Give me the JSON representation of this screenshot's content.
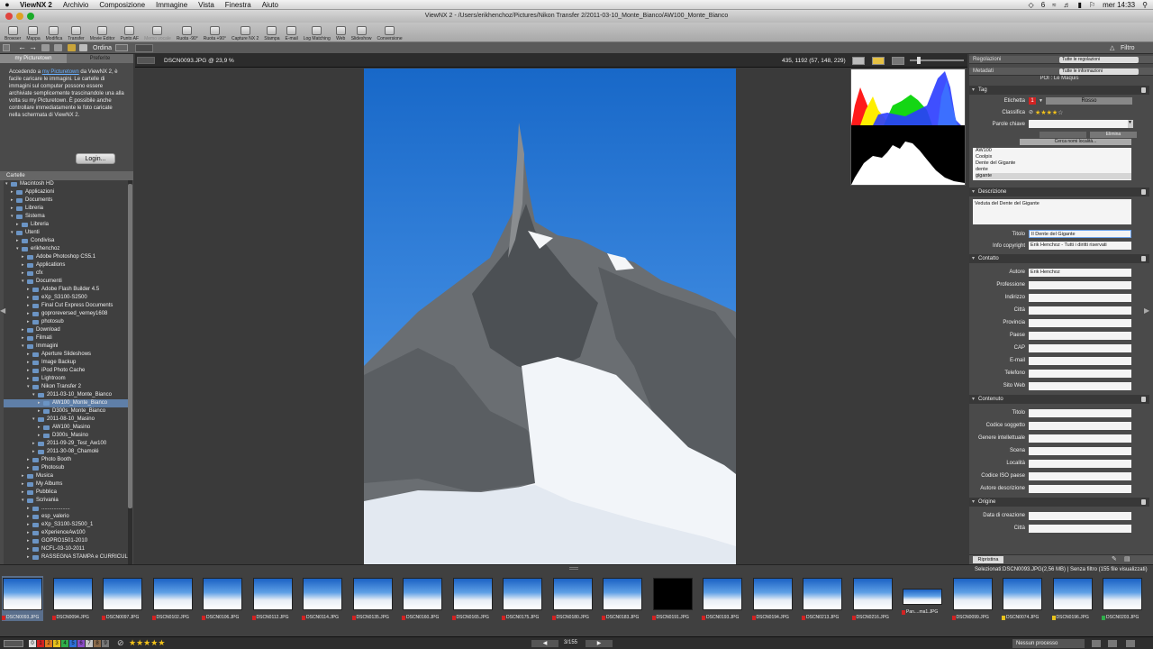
{
  "menubar": {
    "apple": "",
    "app": "ViewNX 2",
    "items": [
      "Archivio",
      "Composizione",
      "Immagine",
      "Vista",
      "Finestra",
      "Aiuto"
    ],
    "right": {
      "battery_num": "6",
      "clock": "mer 14:33"
    }
  },
  "window": {
    "title": "ViewNX 2 - /Users/erikhenchoz/Pictures/Nikon Transfer 2/2011-03-10_Monte_Bianco/AW100_Monte_Bianco"
  },
  "toolbar": {
    "items": [
      {
        "label": "Browser",
        "enabled": true
      },
      {
        "label": "Mappa",
        "enabled": true
      },
      {
        "label": "Modifica",
        "enabled": true
      },
      {
        "label": "Transfer",
        "enabled": true
      },
      {
        "label": "Movie Editor",
        "enabled": true
      },
      {
        "label": "Punto AF",
        "enabled": true
      },
      {
        "label": "Memo vocale",
        "enabled": false
      },
      {
        "label": "Ruota -90°",
        "enabled": true
      },
      {
        "label": "Ruota +90°",
        "enabled": true
      },
      {
        "label": "Capture NX 2",
        "enabled": true
      },
      {
        "label": "Stampa",
        "enabled": true
      },
      {
        "label": "E-mail",
        "enabled": true
      },
      {
        "label": "Log Matching",
        "enabled": true
      },
      {
        "label": "Web",
        "enabled": true
      },
      {
        "label": "Slideshow",
        "enabled": true
      },
      {
        "label": "Conversione",
        "enabled": true
      }
    ]
  },
  "subbar": {
    "sort_label": "Ordina",
    "filter_label": "Filtro"
  },
  "left": {
    "tabs": [
      "my Picturetown",
      "Preferite"
    ],
    "intro_pre": "Accedendo a ",
    "intro_link": "my Picturetown",
    "intro_post": " da ViewNX 2, è facile caricare le immagini. Le cartelle di immagini sul computer possono essere archiviate semplicemente trascinandole una alla volta su my Picturetown. È possibile anche controllare immediatamente le foto caricate nella schermata di ViewNX 2.",
    "login": "Login...",
    "folders_title": "Cartelle",
    "tree": [
      {
        "label": "Macintosh HD",
        "level": 0,
        "open": true
      },
      {
        "label": "Applicazioni",
        "level": 1
      },
      {
        "label": "Documents",
        "level": 1
      },
      {
        "label": "Libreria",
        "level": 1
      },
      {
        "label": "Sistema",
        "level": 1,
        "open": true
      },
      {
        "label": "Libreria",
        "level": 2
      },
      {
        "label": "Utenti",
        "level": 1,
        "open": true
      },
      {
        "label": "Condivisa",
        "level": 2
      },
      {
        "label": "erikhenchoz",
        "level": 2,
        "open": true
      },
      {
        "label": "Adobe Photoshop CS5.1",
        "level": 3
      },
      {
        "label": "Applications",
        "level": 3
      },
      {
        "label": "cfx",
        "level": 3
      },
      {
        "label": "Documenti",
        "level": 3,
        "open": true
      },
      {
        "label": "Adobe Flash Builder 4.5",
        "level": 4
      },
      {
        "label": "eXp_S3100-S2500",
        "level": 4
      },
      {
        "label": "Final Cut Express Documents",
        "level": 4
      },
      {
        "label": "goproreversed_verney1608",
        "level": 4
      },
      {
        "label": "photosub",
        "level": 4
      },
      {
        "label": "Download",
        "level": 3
      },
      {
        "label": "Filmati",
        "level": 3
      },
      {
        "label": "Immagini",
        "level": 3,
        "open": true
      },
      {
        "label": "Aperture Slideshows",
        "level": 4
      },
      {
        "label": "Image Backup",
        "level": 4
      },
      {
        "label": "iPod Photo Cache",
        "level": 4
      },
      {
        "label": "Lightroom",
        "level": 4
      },
      {
        "label": "Nikon Transfer 2",
        "level": 4,
        "open": true
      },
      {
        "label": "2011-03-10_Monte_Bianco",
        "level": 5,
        "open": true
      },
      {
        "label": "AW100_Monte_Bianco",
        "level": 6,
        "selected": true
      },
      {
        "label": "D300s_Monte_Bianco",
        "level": 6
      },
      {
        "label": "2011-08-10_Masino",
        "level": 5,
        "open": true
      },
      {
        "label": "AW100_Masino",
        "level": 6
      },
      {
        "label": "D300s_Masino",
        "level": 6
      },
      {
        "label": "2011-09-29_Test_Aw100",
        "level": 5
      },
      {
        "label": "2011-30-08_Chamolé",
        "level": 5
      },
      {
        "label": "Photo Booth",
        "level": 4
      },
      {
        "label": "Photosub",
        "level": 4
      },
      {
        "label": "Musica",
        "level": 3
      },
      {
        "label": "My Albums",
        "level": 3
      },
      {
        "label": "Pubblica",
        "level": 3
      },
      {
        "label": "Scrivania",
        "level": 3,
        "open": true
      },
      {
        "label": "...................",
        "level": 4
      },
      {
        "label": "esp_valerio",
        "level": 4
      },
      {
        "label": "eXp_S3100-S2500_1",
        "level": 4
      },
      {
        "label": "eXperienceAw100",
        "level": 4
      },
      {
        "label": "GOPRO1501-2010",
        "level": 4
      },
      {
        "label": "NCFL-03-10-2011",
        "level": 4
      },
      {
        "label": "RASSEGNA STAMPA e CURRICULUM",
        "level": 4
      }
    ]
  },
  "viewer": {
    "filename": "DSCN0093.JPG @ 23,9 %",
    "coords": "435, 1192 (57, 148, 229)"
  },
  "right": {
    "adjust_label": "Regolazioni",
    "adjust_value": "Tutte le regolazioni",
    "meta_label": "Metadati",
    "meta_value": "Tutte le informazioni",
    "poi": "POI : Le Maquis",
    "tag_title": "Tag",
    "etichetta_label": "Etichetta",
    "etichetta_num": "1",
    "etichetta_value": "Rosso",
    "classifica_label": "Classifica",
    "rating": 4,
    "parole_label": "Parole chiave",
    "elimina": "Elimina",
    "cerca": "Cerca nomi località...",
    "keywords": [
      "AW100",
      "Coolpix",
      "Dente del Gigante",
      "dente",
      "gigante"
    ],
    "desc_title": "Descrizione",
    "desc_value": "Veduta del Dente del Gigante",
    "titolo_label": "Titolo",
    "titolo_value": "Il Dente del Gigante",
    "copy_label": "Info copyright",
    "copy_value": "Erik Henchoz - Tutti i diritti riservati",
    "contatto_title": "Contatto",
    "contatto_fields": [
      {
        "label": "Autore",
        "value": "Erik Henchoz"
      },
      {
        "label": "Professione",
        "value": ""
      },
      {
        "label": "Indirizzo",
        "value": ""
      },
      {
        "label": "Città",
        "value": ""
      },
      {
        "label": "Provincia",
        "value": ""
      },
      {
        "label": "Paese",
        "value": ""
      },
      {
        "label": "CAP",
        "value": ""
      },
      {
        "label": "E-mail",
        "value": ""
      },
      {
        "label": "Telefono",
        "value": ""
      },
      {
        "label": "Sito Web",
        "value": ""
      }
    ],
    "contenuto_title": "Contenuto",
    "contenuto_fields": [
      {
        "label": "Titolo",
        "value": ""
      },
      {
        "label": "Codice soggetto",
        "value": ""
      },
      {
        "label": "Genere intellettuale",
        "value": ""
      },
      {
        "label": "Scena",
        "value": ""
      },
      {
        "label": "Località",
        "value": ""
      },
      {
        "label": "Codice ISO paese",
        "value": ""
      },
      {
        "label": "Autore descrizione",
        "value": ""
      }
    ],
    "origine_title": "Origine",
    "origine_fields": [
      {
        "label": "Data di creazione",
        "value": ""
      },
      {
        "label": "Città",
        "value": ""
      }
    ],
    "ripristina": "Ripristina"
  },
  "selection_info": "Selezionati:DSCN0093.JPG(2,56 MB) | Senza filtro (155 file visualizzati)",
  "thumbs": [
    {
      "name": "DSCN0093.JPG",
      "label": "red"
    },
    {
      "name": "DSCN0094.JPG",
      "label": "red"
    },
    {
      "name": "DSCN0097.JPG",
      "label": "red"
    },
    {
      "name": "DSCN0102.JPG",
      "label": "red"
    },
    {
      "name": "DSCN0106.JPG",
      "label": "red"
    },
    {
      "name": "DSCN0112.JPG",
      "label": "red"
    },
    {
      "name": "DSCN0114.JPG",
      "label": "red"
    },
    {
      "name": "DSCN0135.JPG",
      "label": "red"
    },
    {
      "name": "DSCN0160.JPG",
      "label": "red"
    },
    {
      "name": "DSCN0165.JPG",
      "label": "red"
    },
    {
      "name": "DSCN0175.JPG",
      "label": "red"
    },
    {
      "name": "DSCN0180.JPG",
      "label": "red"
    },
    {
      "name": "DSCN0183.JPG",
      "label": "red"
    },
    {
      "name": "DSCN0191.JPG",
      "label": "red"
    },
    {
      "name": "DSCN0193.JPG",
      "label": "red"
    },
    {
      "name": "DSCN0194.JPG",
      "label": "red"
    },
    {
      "name": "DSCN0213.JPG",
      "label": "red"
    },
    {
      "name": "DSCN0216.JPG",
      "label": "red"
    },
    {
      "name": "Pan....ma1.JPG",
      "label": "red"
    },
    {
      "name": "DSCN0099.JPG",
      "label": "red"
    },
    {
      "name": "DSCN0074.JPG",
      "label": "yellow"
    },
    {
      "name": "DSCN0196.JPG",
      "label": "yellow"
    },
    {
      "name": "DSCN0203.JPG",
      "label": "green"
    }
  ],
  "status": {
    "labels": [
      "0",
      "1",
      "2",
      "3",
      "4",
      "5",
      "6",
      "7",
      "8",
      "9"
    ],
    "rating": 5,
    "page": "3/155",
    "process": "Nessun processo"
  },
  "colors": {
    "label_red": "#d22222",
    "label_yellow": "#e8c21c",
    "label_green": "#2fae4a",
    "selection": "#5f7fa8"
  }
}
